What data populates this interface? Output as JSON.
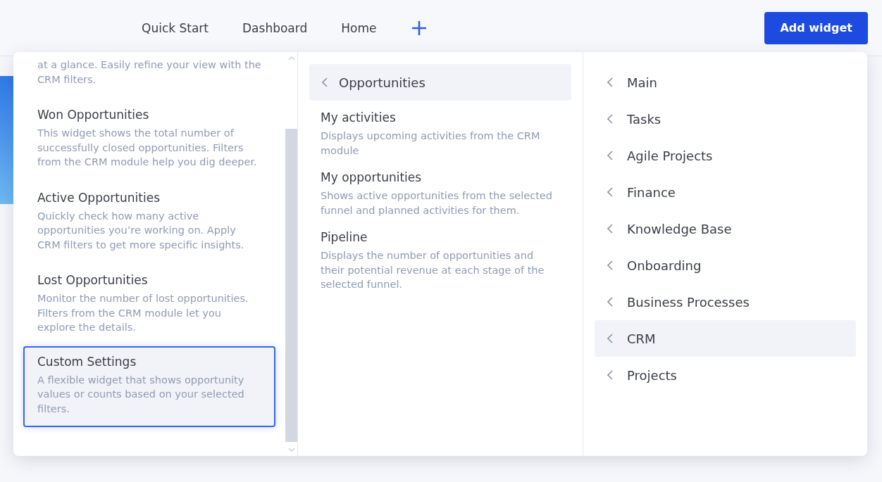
{
  "tabs": [
    {
      "label": "Quick Start"
    },
    {
      "label": "Dashboard"
    },
    {
      "label": "Home"
    }
  ],
  "add_button": {
    "label": "Add widget"
  },
  "widgets": [
    {
      "description": "at a glance. Easily refine your view with the CRM filters.",
      "selected": false
    },
    {
      "title": "Won Opportunities",
      "description": "This widget shows the total number of successfully closed opportunities. Filters from the CRM module help you dig deeper.",
      "selected": false
    },
    {
      "title": "Active Opportunities",
      "description": "Quickly check how many active opportunities you’re working on. Apply CRM filters to get more specific insights.",
      "selected": false
    },
    {
      "title": "Lost Opportunities",
      "description": "Monitor the number of lost opportunities. Filters from the CRM module let you explore the details.",
      "selected": false
    },
    {
      "title": "Custom Settings",
      "description": "A flexible widget that shows opportunity values or counts based on your selected filters.",
      "selected": true
    }
  ],
  "subgroup": {
    "title": "Opportunities",
    "items": [
      {
        "title": "My activities",
        "description": "Displays upcoming activities from the CRM module"
      },
      {
        "title": "My opportunities",
        "description": "Shows active opportunities from the selected funnel and planned activities for them."
      },
      {
        "title": "Pipeline",
        "description": "Displays the number of opportunities and their potential revenue at each stage of the selected funnel."
      }
    ]
  },
  "categories": [
    {
      "label": "Main",
      "selected": false
    },
    {
      "label": "Tasks",
      "selected": false
    },
    {
      "label": "Agile Projects",
      "selected": false
    },
    {
      "label": "Finance",
      "selected": false
    },
    {
      "label": "Knowledge Base",
      "selected": false
    },
    {
      "label": "Onboarding",
      "selected": false
    },
    {
      "label": "Business Processes",
      "selected": false
    },
    {
      "label": "CRM",
      "selected": true
    },
    {
      "label": "Projects",
      "selected": false
    }
  ]
}
